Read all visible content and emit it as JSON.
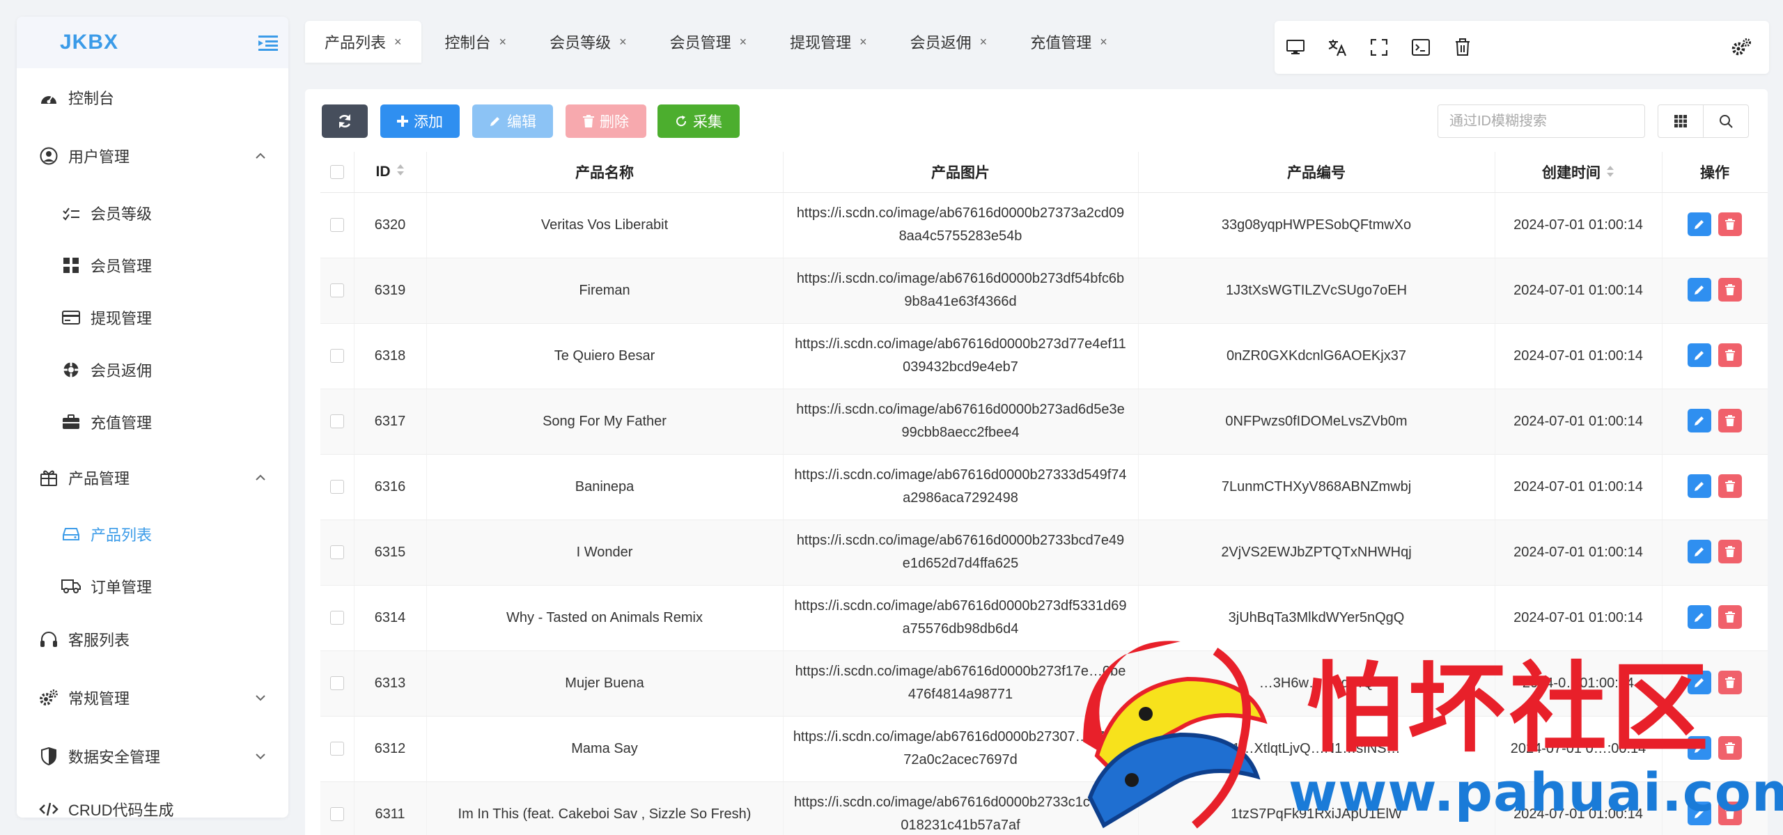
{
  "logo": "JKBX",
  "sidebar": {
    "items": [
      {
        "label": "控制台"
      },
      {
        "label": "用户管理"
      },
      {
        "label": "会员等级"
      },
      {
        "label": "会员管理"
      },
      {
        "label": "提现管理"
      },
      {
        "label": "会员返佣"
      },
      {
        "label": "充值管理"
      },
      {
        "label": "产品管理"
      },
      {
        "label": "产品列表"
      },
      {
        "label": "订单管理"
      },
      {
        "label": "客服列表"
      },
      {
        "label": "常规管理"
      },
      {
        "label": "数据安全管理"
      },
      {
        "label": "CRUD代码生成"
      }
    ]
  },
  "tabs": [
    {
      "label": "产品列表"
    },
    {
      "label": "控制台"
    },
    {
      "label": "会员等级"
    },
    {
      "label": "会员管理"
    },
    {
      "label": "提现管理"
    },
    {
      "label": "会员返佣"
    },
    {
      "label": "充值管理"
    }
  ],
  "tab_close_glyph": "×",
  "toolbar": {
    "add_label": "添加",
    "edit_label": "编辑",
    "delete_label": "删除",
    "collect_label": "采集",
    "search_placeholder": "通过ID模糊搜索"
  },
  "table": {
    "headers": {
      "id": "ID",
      "name": "产品名称",
      "image": "产品图片",
      "code": "产品编号",
      "created": "创建时间",
      "ops": "操作"
    },
    "rows": [
      {
        "id": "6320",
        "name": "Veritas Vos Liberabit",
        "image": "https://i.scdn.co/image/ab67616d0000b27373a2cd098aa4c5755283e54b",
        "code": "33g08yqpHWPESobQFtmwXo",
        "created": "2024-07-01 01:00:14"
      },
      {
        "id": "6319",
        "name": "Fireman",
        "image": "https://i.scdn.co/image/ab67616d0000b273df54bfc6b9b8a41e63f4366d",
        "code": "1J3tXsWGTILZVcSUgo7oEH",
        "created": "2024-07-01 01:00:14"
      },
      {
        "id": "6318",
        "name": "Te Quiero Besar",
        "image": "https://i.scdn.co/image/ab67616d0000b273d77e4ef11039432bcd9e4eb7",
        "code": "0nZR0GXKdcnlG6AOEKjx37",
        "created": "2024-07-01 01:00:14"
      },
      {
        "id": "6317",
        "name": "Song For My Father",
        "image": "https://i.scdn.co/image/ab67616d0000b273ad6d5e3e99cbb8aecc2fbee4",
        "code": "0NFPwzs0fIDOMeLvsZVb0m",
        "created": "2024-07-01 01:00:14"
      },
      {
        "id": "6316",
        "name": "Baninepa",
        "image": "https://i.scdn.co/image/ab67616d0000b27333d549f74a2986aca7292498",
        "code": "7LunmCTHXyV868ABNZmwbj",
        "created": "2024-07-01 01:00:14"
      },
      {
        "id": "6315",
        "name": "I Wonder",
        "image": "https://i.scdn.co/image/ab67616d0000b2733bcd7e49e1d652d7d4ffa625",
        "code": "2VjVS2EWJbZPTQTxNHWHqj",
        "created": "2024-07-01 01:00:14"
      },
      {
        "id": "6314",
        "name": "Why - Tasted on Animals Remix",
        "image": "https://i.scdn.co/image/ab67616d0000b273df5331d69a75576db98db6d4",
        "code": "3jUhBqTa3MlkdWYer5nQgQ",
        "created": "2024-07-01 01:00:14"
      },
      {
        "id": "6313",
        "name": "Mujer Buena",
        "image": "https://i.scdn.co/image/ab67616d0000b273f17e…0be476f4814a98771",
        "code": "…3H6w…Q0q…Q",
        "created": "2024-0…01:00:14"
      },
      {
        "id": "6312",
        "name": "Mama Say",
        "image": "https://i.scdn.co/image/ab67616d0000b27307…e7e0372a0c2acec7697d",
        "code": "1…XtlqtLjvQ…N1…sfNS…",
        "created": "2024-07-01 0…:00:14"
      },
      {
        "id": "6311",
        "name": "Im In This (feat. Cakeboi Sav , Sizzle So Fresh)",
        "image": "https://i.scdn.co/image/ab67616d0000b2733c1c7…d5018231c41b57a7af",
        "code": "1tzS7PqFk91RxiJApU1ElW",
        "created": "2024-07-01 01:00:14"
      }
    ]
  },
  "watermark": {
    "text": "怕坏社区",
    "url": "www.pahuai.com"
  },
  "colors": {
    "primary": "#3b9be8",
    "add": "#2f8ff0",
    "edit": "#8cc3f5",
    "delete": "#f7a9ae",
    "collect": "#4cae2e",
    "refresh": "#464e5c"
  }
}
